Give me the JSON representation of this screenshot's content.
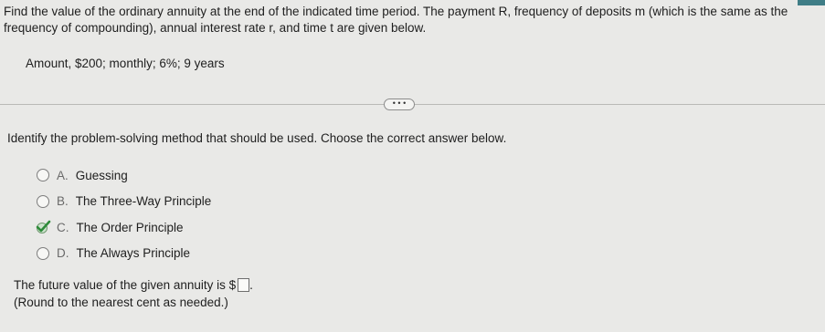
{
  "question": {
    "text": "Find the value of the ordinary annuity at the end of the indicated time period. The payment R, frequency of deposits m (which is the same as the frequency of compounding), annual interest rate r, and time t are given below.",
    "given": "Amount, $200; monthly; 6%; 9 years"
  },
  "more_button": {
    "label": "• • •"
  },
  "part1": {
    "prompt": "Identify the problem-solving method that should be used. Choose the correct answer below.",
    "options": [
      {
        "letter": "A.",
        "label": "Guessing",
        "selected": false
      },
      {
        "letter": "B.",
        "label": "The Three-Way Principle",
        "selected": false
      },
      {
        "letter": "C.",
        "label": "The Order Principle",
        "selected": true
      },
      {
        "letter": "D.",
        "label": "The Always Principle",
        "selected": false
      }
    ]
  },
  "part2": {
    "prefix": "The future value of the given annuity is $",
    "suffix": ".",
    "hint": "(Round to the nearest cent as needed.)"
  },
  "colors": {
    "accent": "#3f7d86",
    "check": "#2e8b3a",
    "background": "#e9e9e7"
  }
}
